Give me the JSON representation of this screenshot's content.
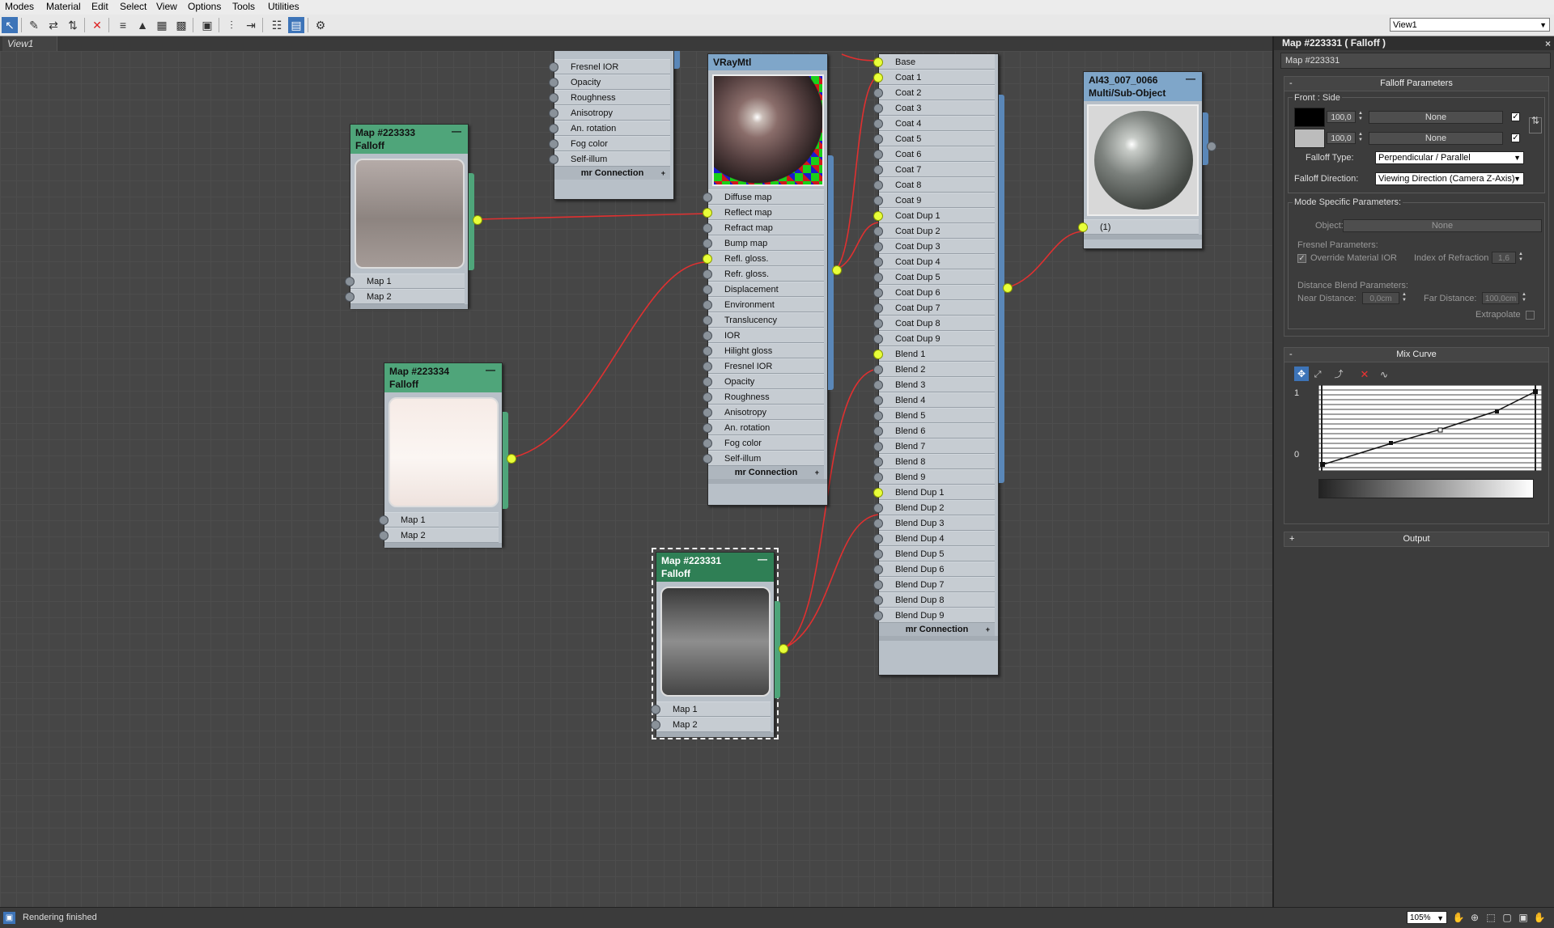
{
  "menu": {
    "items": [
      "Modes",
      "Material",
      "Edit",
      "Select",
      "View",
      "Options",
      "Tools",
      "Utilities"
    ]
  },
  "toolbar": {
    "view_selector": "View1"
  },
  "view_tab": {
    "label": "View1"
  },
  "nodes": {
    "vraymtl_top": {
      "slots": [
        "Fresnel IOR",
        "Opacity",
        "Roughness",
        "Anisotropy",
        "An. rotation",
        "Fog color",
        "Self-illum"
      ],
      "mr_label": "mr Connection"
    },
    "vraymtl": {
      "title": "VRayMtl",
      "slots": [
        "Diffuse map",
        "Reflect map",
        "Refract map",
        "Bump map",
        "Refl. gloss.",
        "Refr. gloss.",
        "Displacement",
        "Environment",
        "Translucency",
        "IOR",
        "Hilight gloss",
        "Fresnel IOR",
        "Opacity",
        "Roughness",
        "Anisotropy",
        "An. rotation",
        "Fog color",
        "Self-illum"
      ],
      "mr_label": "mr Connection"
    },
    "map223333": {
      "title": "Map #223333",
      "subtitle": "Falloff",
      "slots": [
        "Map 1",
        "Map 2"
      ]
    },
    "map223334": {
      "title": "Map #223334",
      "subtitle": "Falloff",
      "slots": [
        "Map 1",
        "Map 2"
      ]
    },
    "map223331": {
      "title": "Map #223331",
      "subtitle": "Falloff",
      "slots": [
        "Map 1",
        "Map 2"
      ]
    },
    "blend": {
      "slots": [
        "Base",
        "Coat 1",
        "Coat 2",
        "Coat 3",
        "Coat 4",
        "Coat 5",
        "Coat 6",
        "Coat 7",
        "Coat 8",
        "Coat 9",
        "Coat Dup 1",
        "Coat Dup 2",
        "Coat Dup 3",
        "Coat Dup 4",
        "Coat Dup 5",
        "Coat Dup 6",
        "Coat Dup 7",
        "Coat Dup 8",
        "Coat Dup 9",
        "Blend 1",
        "Blend 2",
        "Blend 3",
        "Blend 4",
        "Blend 5",
        "Blend 6",
        "Blend 7",
        "Blend 8",
        "Blend 9",
        "Blend Dup 1",
        "Blend Dup 2",
        "Blend Dup 3",
        "Blend Dup 4",
        "Blend Dup 5",
        "Blend Dup 6",
        "Blend Dup 7",
        "Blend Dup 8",
        "Blend Dup 9"
      ],
      "mr_label": "mr Connection"
    },
    "multi": {
      "title": "AI43_007_0066",
      "subtitle": "Multi/Sub-Object",
      "slot": "(1)"
    }
  },
  "panel": {
    "title": "Map #223331  ( Falloff )",
    "name_field": "Map #223331",
    "falloff_params": {
      "header": "Falloff Parameters",
      "front_side": "Front : Side",
      "front_value": "100,0",
      "side_value": "100,0",
      "front_map": "None",
      "side_map": "None",
      "front_color": "#000000",
      "side_color": "#bcbcbc",
      "falloff_type_label": "Falloff Type:",
      "falloff_type": "Perpendicular / Parallel",
      "falloff_direction_label": "Falloff Direction:",
      "falloff_direction": "Viewing Direction (Camera Z-Axis)"
    },
    "mode_params": {
      "header": "Mode Specific Parameters:",
      "object_label": "Object:",
      "object_value": "None",
      "fresnel_header": "Fresnel Parameters:",
      "override_label": "Override Material IOR",
      "ior_label": "Index of Refraction",
      "ior_value": "1,6",
      "distance_header": "Distance Blend Parameters:",
      "near_label": "Near Distance:",
      "near_value": "0,0cm",
      "far_label": "Far Distance:",
      "far_value": "100,0cm",
      "extrapolate_label": "Extrapolate"
    },
    "mix_curve": {
      "header": "Mix Curve",
      "y_max": "1",
      "y_min": "0"
    },
    "output": {
      "header": "Output"
    }
  },
  "status": {
    "text": "Rendering finished",
    "zoom": "105%"
  }
}
